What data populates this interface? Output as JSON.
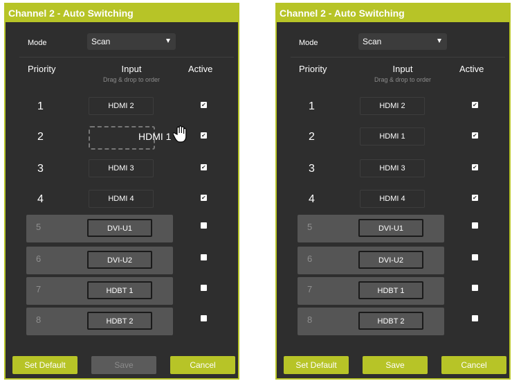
{
  "left": {
    "title": "Channel 2 - Auto Switching",
    "mode_label": "Mode",
    "mode_value": "Scan",
    "headers": {
      "priority": "Priority",
      "input": "Input",
      "input_hint": "Drag & drop to order",
      "active": "Active"
    },
    "rows": [
      {
        "priority": "1",
        "input": "HDMI 2",
        "active": true
      },
      {
        "priority": "2",
        "input": "HDMI 1",
        "active": true,
        "dragging": true
      },
      {
        "priority": "3",
        "input": "HDMI 3",
        "active": true
      },
      {
        "priority": "4",
        "input": "HDMI 4",
        "active": true
      },
      {
        "priority": "5",
        "input": "DVI-U1",
        "active": false
      },
      {
        "priority": "6",
        "input": "DVI-U2",
        "active": false
      },
      {
        "priority": "7",
        "input": "HDBT 1",
        "active": false
      },
      {
        "priority": "8",
        "input": "HDBT 2",
        "active": false
      }
    ],
    "buttons": {
      "set_default": "Set Default",
      "save": "Save",
      "cancel": "Cancel"
    },
    "save_enabled": false
  },
  "right": {
    "title": "Channel 2 - Auto Switching",
    "mode_label": "Mode",
    "mode_value": "Scan",
    "headers": {
      "priority": "Priority",
      "input": "Input",
      "input_hint": "Drag & drop to order",
      "active": "Active"
    },
    "rows": [
      {
        "priority": "1",
        "input": "HDMI 2",
        "active": true
      },
      {
        "priority": "2",
        "input": "HDMI 1",
        "active": true
      },
      {
        "priority": "3",
        "input": "HDMI 3",
        "active": true
      },
      {
        "priority": "4",
        "input": "HDMI 4",
        "active": true
      },
      {
        "priority": "5",
        "input": "DVI-U1",
        "active": false
      },
      {
        "priority": "6",
        "input": "DVI-U2",
        "active": false
      },
      {
        "priority": "7",
        "input": "HDBT 1",
        "active": false
      },
      {
        "priority": "8",
        "input": "HDBT 2",
        "active": false
      }
    ],
    "buttons": {
      "set_default": "Set Default",
      "save": "Save",
      "cancel": "Cancel"
    },
    "save_enabled": true
  },
  "colors": {
    "accent": "#b7c427",
    "panel_bg": "#2e2e2e",
    "inactive_row": "#555555"
  }
}
